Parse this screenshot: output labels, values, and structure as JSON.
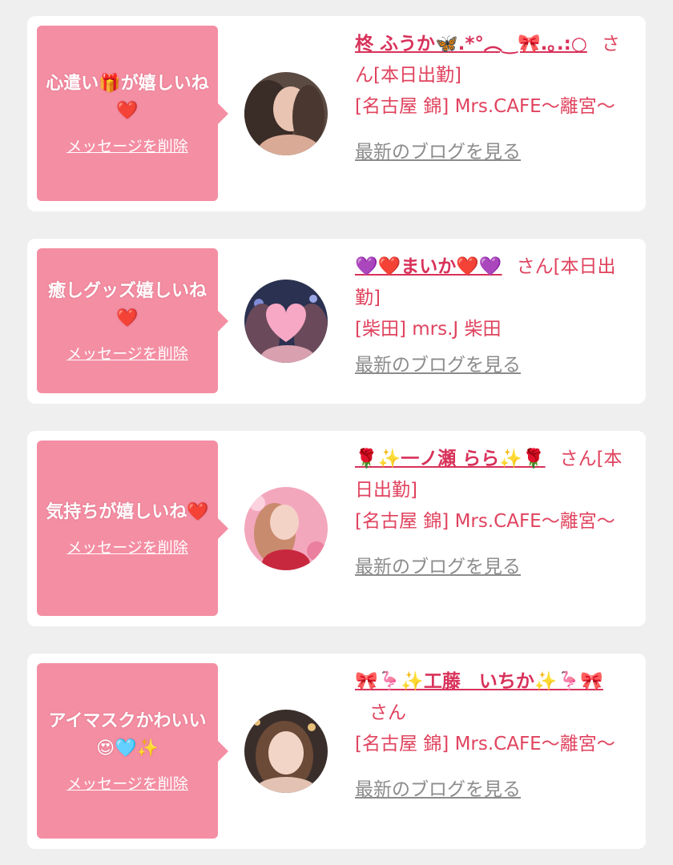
{
  "cards": [
    {
      "message": "心遣い🎁が嬉しいね❤️",
      "delete_label": "メッセージを削除",
      "name": "柊 ふうか🦋.*°︵‿🎀.｡.:○",
      "suffix": "さん",
      "status": "[本日出勤]",
      "shop": "[名古屋 錦] Mrs.CAFE〜離宮〜",
      "blog_label": "最新のブログを見る"
    },
    {
      "message": "癒しグッズ嬉しいね❤️",
      "delete_label": "メッセージを削除",
      "name": "💜❤️まいか❤️💜",
      "suffix": "さん",
      "status": "[本日出勤]",
      "shop": "[柴田] mrs.J 柴田",
      "blog_label": "最新のブログを見る"
    },
    {
      "message": "気持ちが嬉しいね❤️",
      "delete_label": "メッセージを削除",
      "name": "🌹✨一ノ瀬 らら✨🌹",
      "suffix": "さん",
      "status": "[本日出勤]",
      "shop": "[名古屋 錦] Mrs.CAFE〜離宮〜",
      "blog_label": "最新のブログを見る"
    },
    {
      "message": "アイマスクかわいい😍🩵✨",
      "delete_label": "メッセージを削除",
      "name": "🎀🦩✨工藤　いちか✨🦩🎀",
      "suffix": "さん",
      "status": "",
      "shop": "[名古屋 錦] Mrs.CAFE〜離宮〜",
      "blog_label": "最新のブログを見る"
    }
  ],
  "colors": {
    "background": "#efefef",
    "card": "#ffffff",
    "bubble": "#f48ea3",
    "name": "#d8325a",
    "text": "#e0435e",
    "link_gray": "#8c8c8c"
  }
}
